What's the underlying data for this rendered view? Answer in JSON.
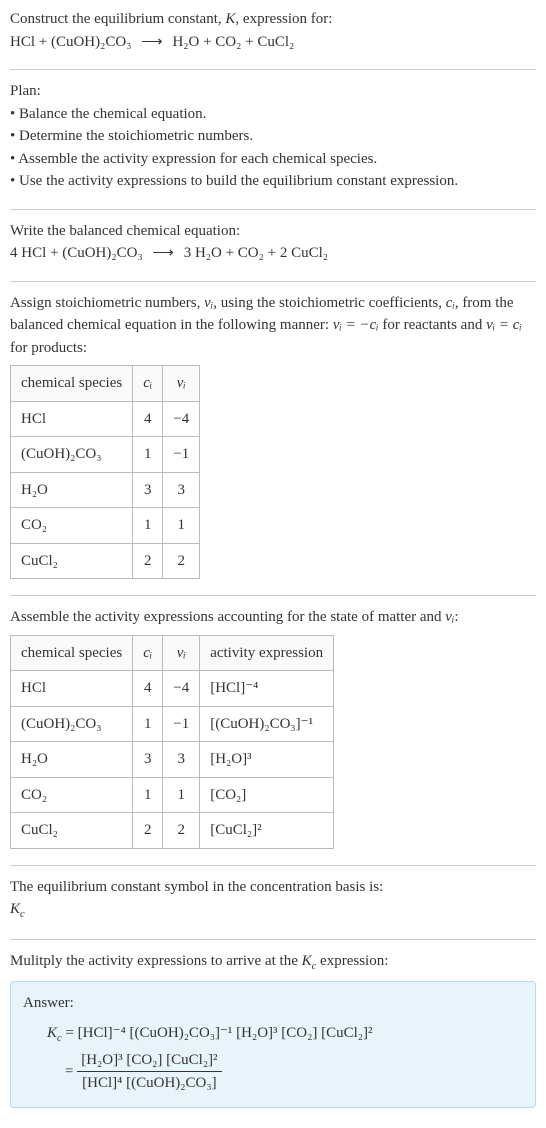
{
  "intro": {
    "line1_pre": "Construct the equilibrium constant, ",
    "line1_K": "K",
    "line1_post": ", expression for:",
    "eq_lhs": "HCl + (CuOH)₂CO₃",
    "arrow": "⟶",
    "eq_rhs": "H₂O + CO₂ + CuCl₂"
  },
  "plan": {
    "heading": "Plan:",
    "items": [
      "Balance the chemical equation.",
      "Determine the stoichiometric numbers.",
      "Assemble the activity expression for each chemical species.",
      "Use the activity expressions to build the equilibrium constant expression."
    ]
  },
  "balanced": {
    "heading": "Write the balanced chemical equation:",
    "lhs": "4 HCl + (CuOH)₂CO₃",
    "arrow": "⟶",
    "rhs": "3 H₂O + CO₂ + 2 CuCl₂"
  },
  "stoich": {
    "text_pre": "Assign stoichiometric numbers, ",
    "nu": "νᵢ",
    "text_mid1": ", using the stoichiometric coefficients, ",
    "ci": "cᵢ",
    "text_mid2": ", from the balanced chemical equation in the following manner: ",
    "rel1": "νᵢ = −cᵢ",
    "text_mid3": " for reactants and ",
    "rel2": "νᵢ = cᵢ",
    "text_post": " for products:",
    "headers": {
      "h1": "chemical species",
      "h2": "cᵢ",
      "h3": "νᵢ"
    },
    "rows": [
      {
        "sp": "HCl",
        "c": "4",
        "v": "−4"
      },
      {
        "sp": "(CuOH)₂CO₃",
        "c": "1",
        "v": "−1"
      },
      {
        "sp": "H₂O",
        "c": "3",
        "v": "3"
      },
      {
        "sp": "CO₂",
        "c": "1",
        "v": "1"
      },
      {
        "sp": "CuCl₂",
        "c": "2",
        "v": "2"
      }
    ]
  },
  "activity": {
    "heading_pre": "Assemble the activity expressions accounting for the state of matter and ",
    "heading_nu": "νᵢ",
    "heading_post": ":",
    "headers": {
      "h1": "chemical species",
      "h2": "cᵢ",
      "h3": "νᵢ",
      "h4": "activity expression"
    },
    "rows": [
      {
        "sp": "HCl",
        "c": "4",
        "v": "−4",
        "expr": "[HCl]⁻⁴"
      },
      {
        "sp": "(CuOH)₂CO₃",
        "c": "1",
        "v": "−1",
        "expr": "[(CuOH)₂CO₃]⁻¹"
      },
      {
        "sp": "H₂O",
        "c": "3",
        "v": "3",
        "expr": "[H₂O]³"
      },
      {
        "sp": "CO₂",
        "c": "1",
        "v": "1",
        "expr": "[CO₂]"
      },
      {
        "sp": "CuCl₂",
        "c": "2",
        "v": "2",
        "expr": "[CuCl₂]²"
      }
    ]
  },
  "symbol": {
    "text": "The equilibrium constant symbol in the concentration basis is:",
    "kc": "K_c"
  },
  "final": {
    "text_pre": "Mulitply the activity expressions to arrive at the ",
    "kc": "K_c",
    "text_post": " expression:"
  },
  "answer": {
    "label": "Answer:",
    "kc": "K_c",
    "eq": " = ",
    "line1": "[HCl]⁻⁴ [(CuOH)₂CO₃]⁻¹ [H₂O]³ [CO₂] [CuCl₂]²",
    "eq2": "= ",
    "num": "[H₂O]³ [CO₂] [CuCl₂]²",
    "den": "[HCl]⁴ [(CuOH)₂CO₃]"
  },
  "chart_data": {
    "type": "table",
    "tables": [
      {
        "title": "Stoichiometric numbers",
        "columns": [
          "chemical species",
          "c_i",
          "ν_i"
        ],
        "rows": [
          [
            "HCl",
            4,
            -4
          ],
          [
            "(CuOH)2CO3",
            1,
            -1
          ],
          [
            "H2O",
            3,
            3
          ],
          [
            "CO2",
            1,
            1
          ],
          [
            "CuCl2",
            2,
            2
          ]
        ]
      },
      {
        "title": "Activity expressions",
        "columns": [
          "chemical species",
          "c_i",
          "ν_i",
          "activity expression"
        ],
        "rows": [
          [
            "HCl",
            4,
            -4,
            "[HCl]^-4"
          ],
          [
            "(CuOH)2CO3",
            1,
            -1,
            "[(CuOH)2CO3]^-1"
          ],
          [
            "H2O",
            3,
            3,
            "[H2O]^3"
          ],
          [
            "CO2",
            1,
            1,
            "[CO2]"
          ],
          [
            "CuCl2",
            2,
            2,
            "[CuCl2]^2"
          ]
        ]
      }
    ]
  }
}
